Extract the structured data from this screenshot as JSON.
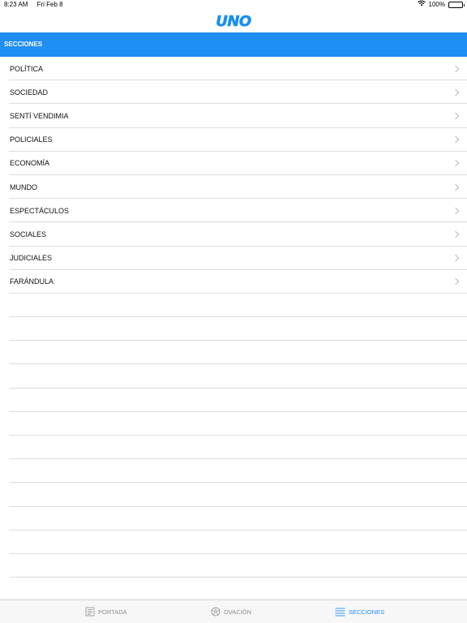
{
  "status_bar": {
    "time": "8:23 AM",
    "date": "Fri Feb 8",
    "battery": "100%"
  },
  "nav": {
    "logo": "UNO"
  },
  "header": {
    "title": "SECCIONES"
  },
  "sections": [
    "POLÍTICA",
    "SOCIEDAD",
    "SENTÍ VENDIMIA",
    "POLICIALES",
    "ECONOMÍA",
    "MUNDO",
    "ESPECTÁCULOS",
    "SOCIALES",
    "JUDICIALES",
    "FARÁNDULA"
  ],
  "tabs": [
    {
      "label": "PORTADA",
      "icon": "newspaper-icon",
      "active": false
    },
    {
      "label": "OVACIÓN",
      "icon": "soccer-ball-icon",
      "active": false
    },
    {
      "label": "SECCIONES",
      "icon": "list-icon",
      "active": true
    }
  ],
  "colors": {
    "accent": "#1f8ef5",
    "inactive_tab": "#8e8e93",
    "separator": "#dcdce0"
  }
}
